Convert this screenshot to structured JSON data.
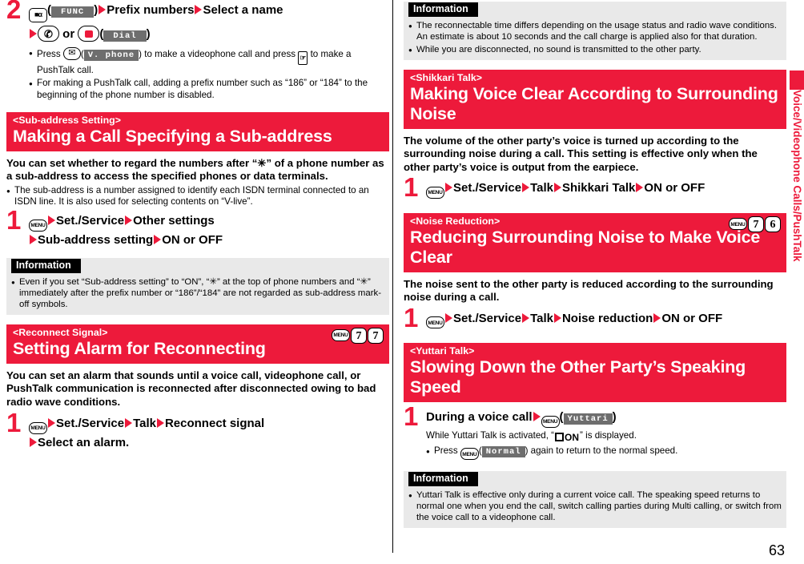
{
  "sidebar": {
    "tab_label": "Voice/Videophone Calls/PushTalk"
  },
  "page_number": "63",
  "left_column": {
    "step2": {
      "number": "2",
      "func_key_paren_open": "(",
      "func_softkey": "FUNC",
      "func_key_paren_close": ")",
      "text1": "Prefix numbers",
      "text2": "Select a name",
      "or_label": "or",
      "dial_paren_open": "(",
      "dial_softkey": "Dial",
      "dial_paren_close": ")",
      "note1_a": "Press",
      "note1_vphone": "V. phone",
      "note1_b": ") to make a videophone call and press",
      "note1_c": "to make a PushTalk call.",
      "note2": "For making a PushTalk call, adding a prefix number such as “186” or “184” to the beginning of the phone number is disabled."
    },
    "section_subaddress": {
      "sub": "<Sub-address Setting>",
      "title": "Making a Call Specifying a Sub-address",
      "lead": "You can set whether to regard the numbers after “✳” of a phone number as a sub-address to access the specified phones or data terminals.",
      "bullet1": "The sub-address is a number assigned to identify each ISDN terminal connected to an ISDN line. It is also used for selecting contents on “V-live”.",
      "step": {
        "number": "1",
        "menu_key": "MENU",
        "item1": "Set./Service",
        "item2": "Other settings",
        "item3": "Sub-address setting",
        "item4": "ON or OFF"
      }
    },
    "info_subaddress": {
      "heading": "Information",
      "bullet1": "Even if you set “Sub-address setting” to “ON”, “✳” at the top of phone numbers and “✳” immediately after the prefix number or “186”/“184” are not regarded as sub-address mark-off symbols."
    },
    "section_reconnect": {
      "sub": "<Reconnect Signal>",
      "title": "Setting Alarm for Reconnecting",
      "keys": [
        "MENU",
        "7",
        "7"
      ],
      "lead": "You can set an alarm that sounds until a voice call, videophone call, or PushTalk communication is reconnected after disconnected owing to bad radio wave conditions.",
      "step": {
        "number": "1",
        "menu_key": "MENU",
        "item1": "Set./Service",
        "item2": "Talk",
        "item3": "Reconnect signal",
        "item4": "Select an alarm."
      }
    }
  },
  "right_column": {
    "info_reconnect": {
      "heading": "Information",
      "bullet1": "The reconnectable time differs depending on the usage status and radio wave conditions. An estimate is about 10 seconds and the call charge is applied also for that duration.",
      "bullet2": "While you are disconnected, no sound is transmitted to the other party."
    },
    "section_shikkari": {
      "sub": "<Shikkari Talk>",
      "title": "Making Voice Clear According to Surrounding Noise",
      "lead": "The volume of the other party’s voice is turned up according to the surrounding noise during a call. This setting is effective only when the other party’s voice is output from the earpiece.",
      "step": {
        "number": "1",
        "menu_key": "MENU",
        "item1": "Set./Service",
        "item2": "Talk",
        "item3": "Shikkari Talk",
        "item4": "ON or OFF"
      }
    },
    "section_noise": {
      "sub": "<Noise Reduction>",
      "title": "Reducing Surrounding Noise to Make Voice Clear",
      "keys": [
        "MENU",
        "7",
        "6"
      ],
      "lead": "The noise sent to the other party is reduced according to the surrounding noise during a call.",
      "step": {
        "number": "1",
        "menu_key": "MENU",
        "item1": "Set./Service",
        "item2": "Talk",
        "item3": "Noise reduction",
        "item4": "ON or OFF"
      }
    },
    "section_yuttari": {
      "sub": "<Yuttari Talk>",
      "title": "Slowing Down the Other Party’s Speaking Speed",
      "step": {
        "number": "1",
        "text1": "During a voice call",
        "menu_key": "MENU",
        "paren_open": "(",
        "softkey": "Yuttari",
        "paren_close": ")"
      },
      "note1_a": "While Yuttari Talk is activated, “",
      "note1_on": "ON",
      "note1_b": "” is displayed.",
      "note2_a": "Press",
      "note2_menu": "MENU",
      "note2_softkey": "Normal",
      "note2_b": ") again to return to the normal speed."
    },
    "info_yuttari": {
      "heading": "Information",
      "bullet1": "Yuttari Talk is effective only during a current voice call. The speaking speed returns to normal one when you end the call, switch calling parties during Multi calling, or switch from the voice call to a videophone call."
    }
  },
  "colors": {
    "brand_red": "#ed1a3b",
    "info_bg": "#e9e9e9",
    "softkey_bg": "#6e6e6e"
  }
}
